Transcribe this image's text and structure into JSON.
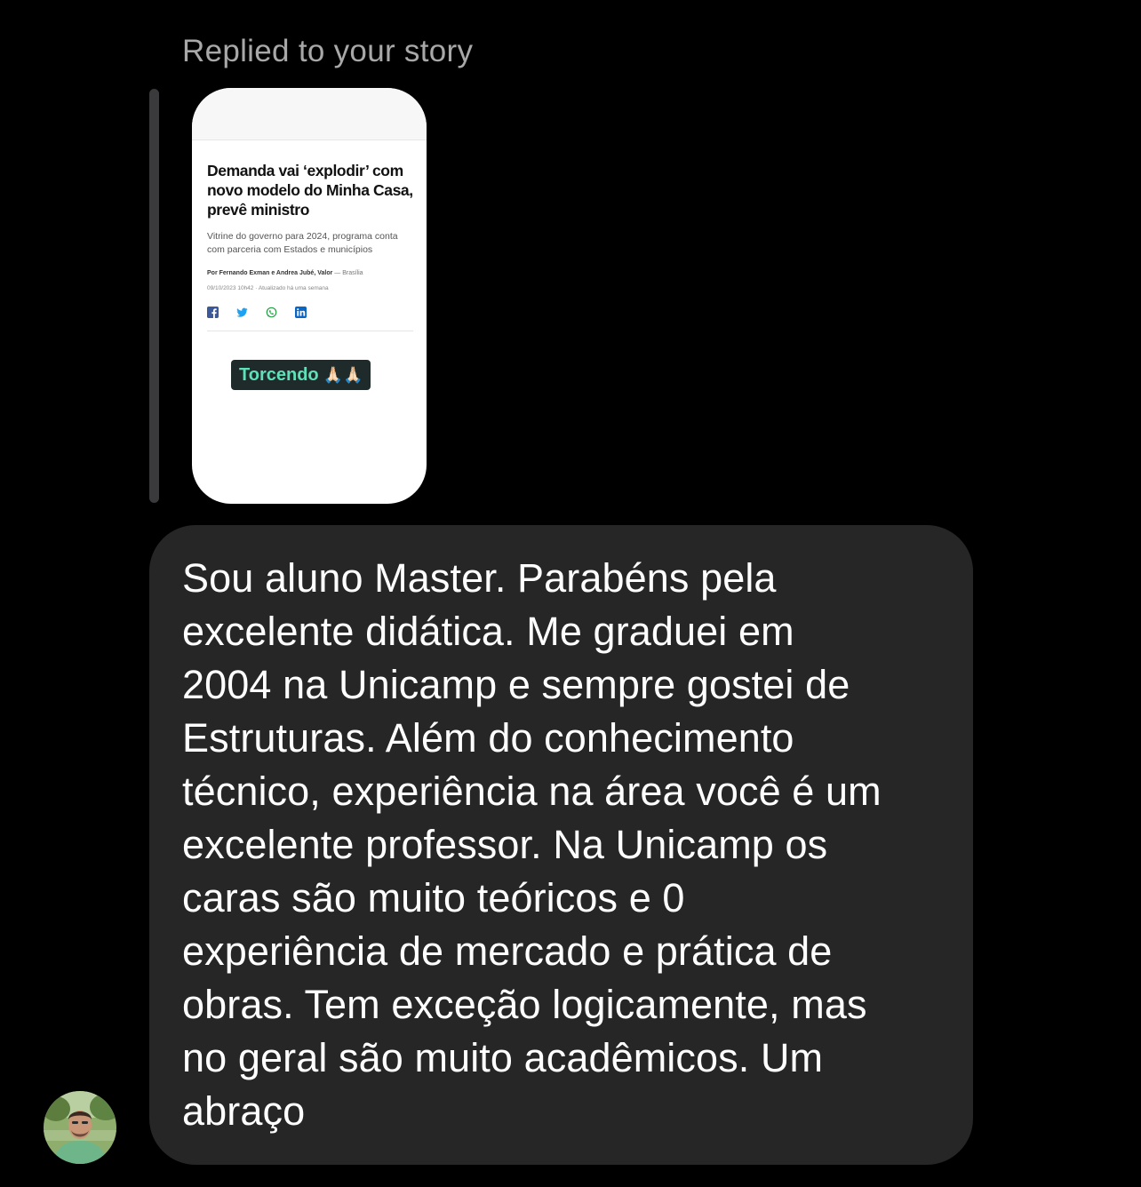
{
  "reply_caption": "Replied to your story",
  "story": {
    "headline": "Demanda vai ‘explodir’ com novo modelo do Minha Casa, prevê ministro",
    "subheadline": "Vitrine do governo para 2024, programa conta com parceria com Estados e municípios",
    "byline_authors": "Por Fernando Exman e Andrea Jubé, Valor",
    "byline_location": " — Brasília",
    "date": "09/10/2023 10h42 · Atualizado há uma semana",
    "share_icons": [
      "facebook-icon",
      "twitter-icon",
      "whatsapp-icon",
      "linkedin-icon"
    ],
    "sticker": {
      "text": "Torcendo",
      "emoji": "🙏🏻🙏🏻"
    }
  },
  "message": {
    "text": "Sou aluno Master. Parabéns pela\nexcelente didática. Me graduei em\n2004 na Unicamp e sempre gostei de\nEstruturas. Além do conhecimento\ntécnico, experiência na área você é um\nexcelente professor. Na Unicamp os\ncaras são muito teóricos e 0\nexperiência de mercado e prática de\nobras. Tem exceção logicamente, mas\nno geral são muito acadêmicos. Um\nabraço"
  },
  "colors": {
    "background": "#000000",
    "bubble": "#262626",
    "caption": "#a8a8a8",
    "quote_bar": "#3a3a3c",
    "sticker_text": "#5ee0b8"
  }
}
